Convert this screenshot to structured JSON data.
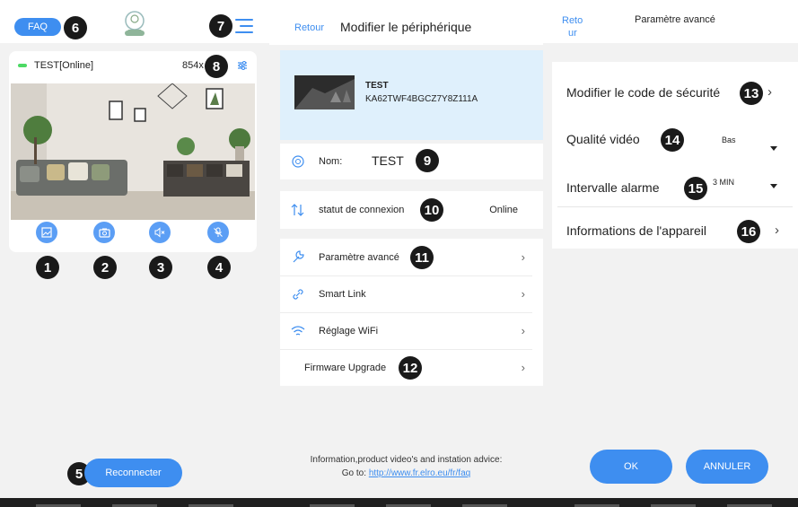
{
  "screen1": {
    "faq_label": "FAQ",
    "camera_name": "TEST[Online]",
    "resolution": "854x",
    "reconnect_label": "Reconnecter"
  },
  "screen2": {
    "back_label": "Retour",
    "title": "Modifier le périphérique",
    "device_name": "TEST",
    "device_id": "KA62TWF4BGCZ7Y8Z111A",
    "name_label": "Nom:",
    "name_value": "TEST",
    "connection_label": "statut de connexion",
    "connection_value": "Online",
    "menu": [
      {
        "label": "Paramètre avancé"
      },
      {
        "label": "Smart Link"
      },
      {
        "label": "Réglage WiFi"
      },
      {
        "label": "Firmware Upgrade"
      }
    ],
    "info_text": "Information,product video's and instation advice:",
    "go_to": "Go to:",
    "info_link": "http://www.fr.elro.eu/fr/faq"
  },
  "screen3": {
    "back_line1": "Reto",
    "back_line2": "ur",
    "title": "Paramètre avancé",
    "security_label": "Modifier le code de sécurité",
    "video_label": "Qualité vidéo",
    "video_value": "Bas",
    "alarm_label": "Intervalle alarme",
    "alarm_value": "3 MIN",
    "device_info_label": "Informations de l'appareil",
    "ok_label": "OK",
    "cancel_label": "ANNULER"
  },
  "badges": [
    "1",
    "2",
    "3",
    "4",
    "5",
    "6",
    "7",
    "8",
    "9",
    "10",
    "11",
    "12",
    "13",
    "14",
    "15",
    "16"
  ],
  "colors": {
    "accent": "#3e8ef0",
    "online": "#4cd964",
    "badge": "#1a1a1a",
    "banner": "#dff0fc"
  },
  "icons": [
    "image-icon",
    "camera-icon",
    "mute-icon",
    "mic-off-icon",
    "menu-icon",
    "settings-sliders-icon",
    "device-icon",
    "sort-arrows-icon",
    "wrench-icon",
    "link-icon",
    "wifi-icon",
    "chevron-right-icon",
    "caret-down-icon"
  ]
}
